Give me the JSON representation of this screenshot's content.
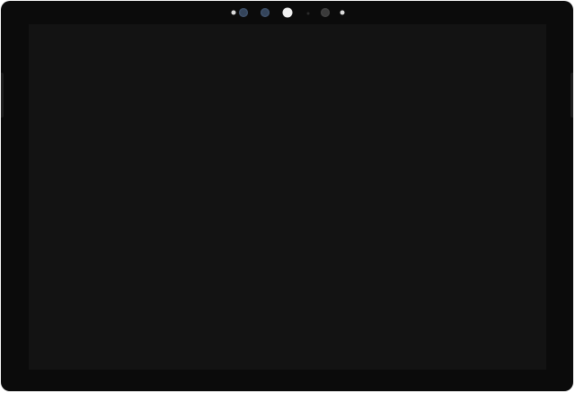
{
  "device": {
    "type": "tablet",
    "screen_state": "off",
    "colors": {
      "bezel": "#0b0b0b",
      "screen": "#131313",
      "sensor_lens": "#34445a",
      "indicator_light": "#f2f2f2"
    },
    "sensors": [
      {
        "name": "sensor-dot-left-icon"
      },
      {
        "name": "ir-sensor-left-icon"
      },
      {
        "name": "ir-sensor-right-icon"
      },
      {
        "name": "ambient-light-icon"
      },
      {
        "name": "microphone-dot-icon"
      },
      {
        "name": "front-camera-icon"
      },
      {
        "name": "sensor-dot-right-icon"
      }
    ]
  }
}
